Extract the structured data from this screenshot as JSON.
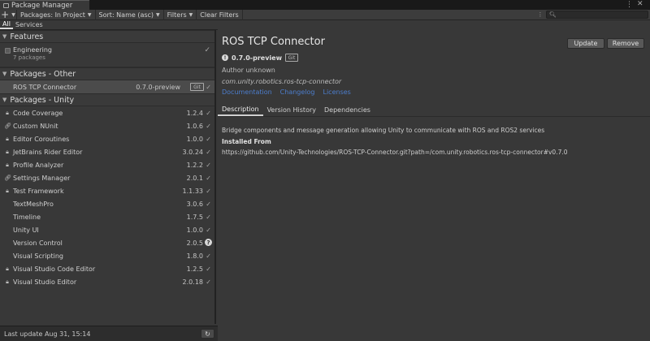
{
  "window": {
    "title": "Package Manager"
  },
  "toolbar": {
    "add_label": "+",
    "packages_scope": "Packages: In Project",
    "sort": "Sort: Name (asc)",
    "filters": "Filters",
    "clear_filters": "Clear Filters",
    "search_placeholder": ""
  },
  "tabs": [
    "All",
    "Services"
  ],
  "features": {
    "header": "Features",
    "items": [
      {
        "name": "Engineering",
        "count": "7 packages"
      }
    ]
  },
  "other": {
    "header": "Packages - Other",
    "items": [
      {
        "name": "ROS TCP Connector",
        "version": "0.7.0-preview",
        "badge": "Git"
      }
    ]
  },
  "unity": {
    "header": "Packages - Unity",
    "items": [
      {
        "name": "Code Coverage",
        "version": "1.2.4",
        "icon": "lock-icon",
        "status": "installed"
      },
      {
        "name": "Custom NUnit",
        "version": "1.0.6",
        "icon": "link-icon",
        "status": "installed"
      },
      {
        "name": "Editor Coroutines",
        "version": "1.0.0",
        "icon": "lock-icon",
        "status": "installed"
      },
      {
        "name": "JetBrains Rider Editor",
        "version": "3.0.24",
        "icon": "lock-icon",
        "status": "installed"
      },
      {
        "name": "Profile Analyzer",
        "version": "1.2.2",
        "icon": "lock-icon",
        "status": "installed"
      },
      {
        "name": "Settings Manager",
        "version": "2.0.1",
        "icon": "link-icon",
        "status": "installed"
      },
      {
        "name": "Test Framework",
        "version": "1.1.33",
        "icon": "lock-icon",
        "status": "installed"
      },
      {
        "name": "TextMeshPro",
        "version": "3.0.6",
        "icon": "",
        "status": "installed"
      },
      {
        "name": "Timeline",
        "version": "1.7.5",
        "icon": "",
        "status": "installed"
      },
      {
        "name": "Unity UI",
        "version": "1.0.0",
        "icon": "",
        "status": "installed"
      },
      {
        "name": "Version Control",
        "version": "2.0.5",
        "icon": "",
        "status": "warning"
      },
      {
        "name": "Visual Scripting",
        "version": "1.8.0",
        "icon": "",
        "status": "installed"
      },
      {
        "name": "Visual Studio Code Editor",
        "version": "1.2.5",
        "icon": "lock-icon",
        "status": "installed"
      },
      {
        "name": "Visual Studio Editor",
        "version": "2.0.18",
        "icon": "lock-icon",
        "status": "installed"
      }
    ]
  },
  "footer": {
    "last_update": "Last update Aug 31, 15:14"
  },
  "details": {
    "title": "ROS TCP Connector",
    "version": "0.7.0-preview",
    "badge": "Git",
    "update_label": "Update",
    "remove_label": "Remove",
    "author": "Author unknown",
    "package_name": "com.unity.robotics.ros-tcp-connector",
    "links": [
      "Documentation",
      "Changelog",
      "Licenses"
    ],
    "tabs": [
      "Description",
      "Version History",
      "Dependencies"
    ],
    "description": "Bridge components and message generation allowing Unity to communicate with ROS and ROS2 services",
    "installed_from_label": "Installed From",
    "installed_from": "https://github.com/Unity-Technologies/ROS-TCP-Connector.git?path=/com.unity.robotics.ros-tcp-connector#v0.7.0"
  },
  "colors": {
    "link": "#4c7dcc",
    "background": "#383838",
    "selected_row": "#4b4b4b"
  }
}
